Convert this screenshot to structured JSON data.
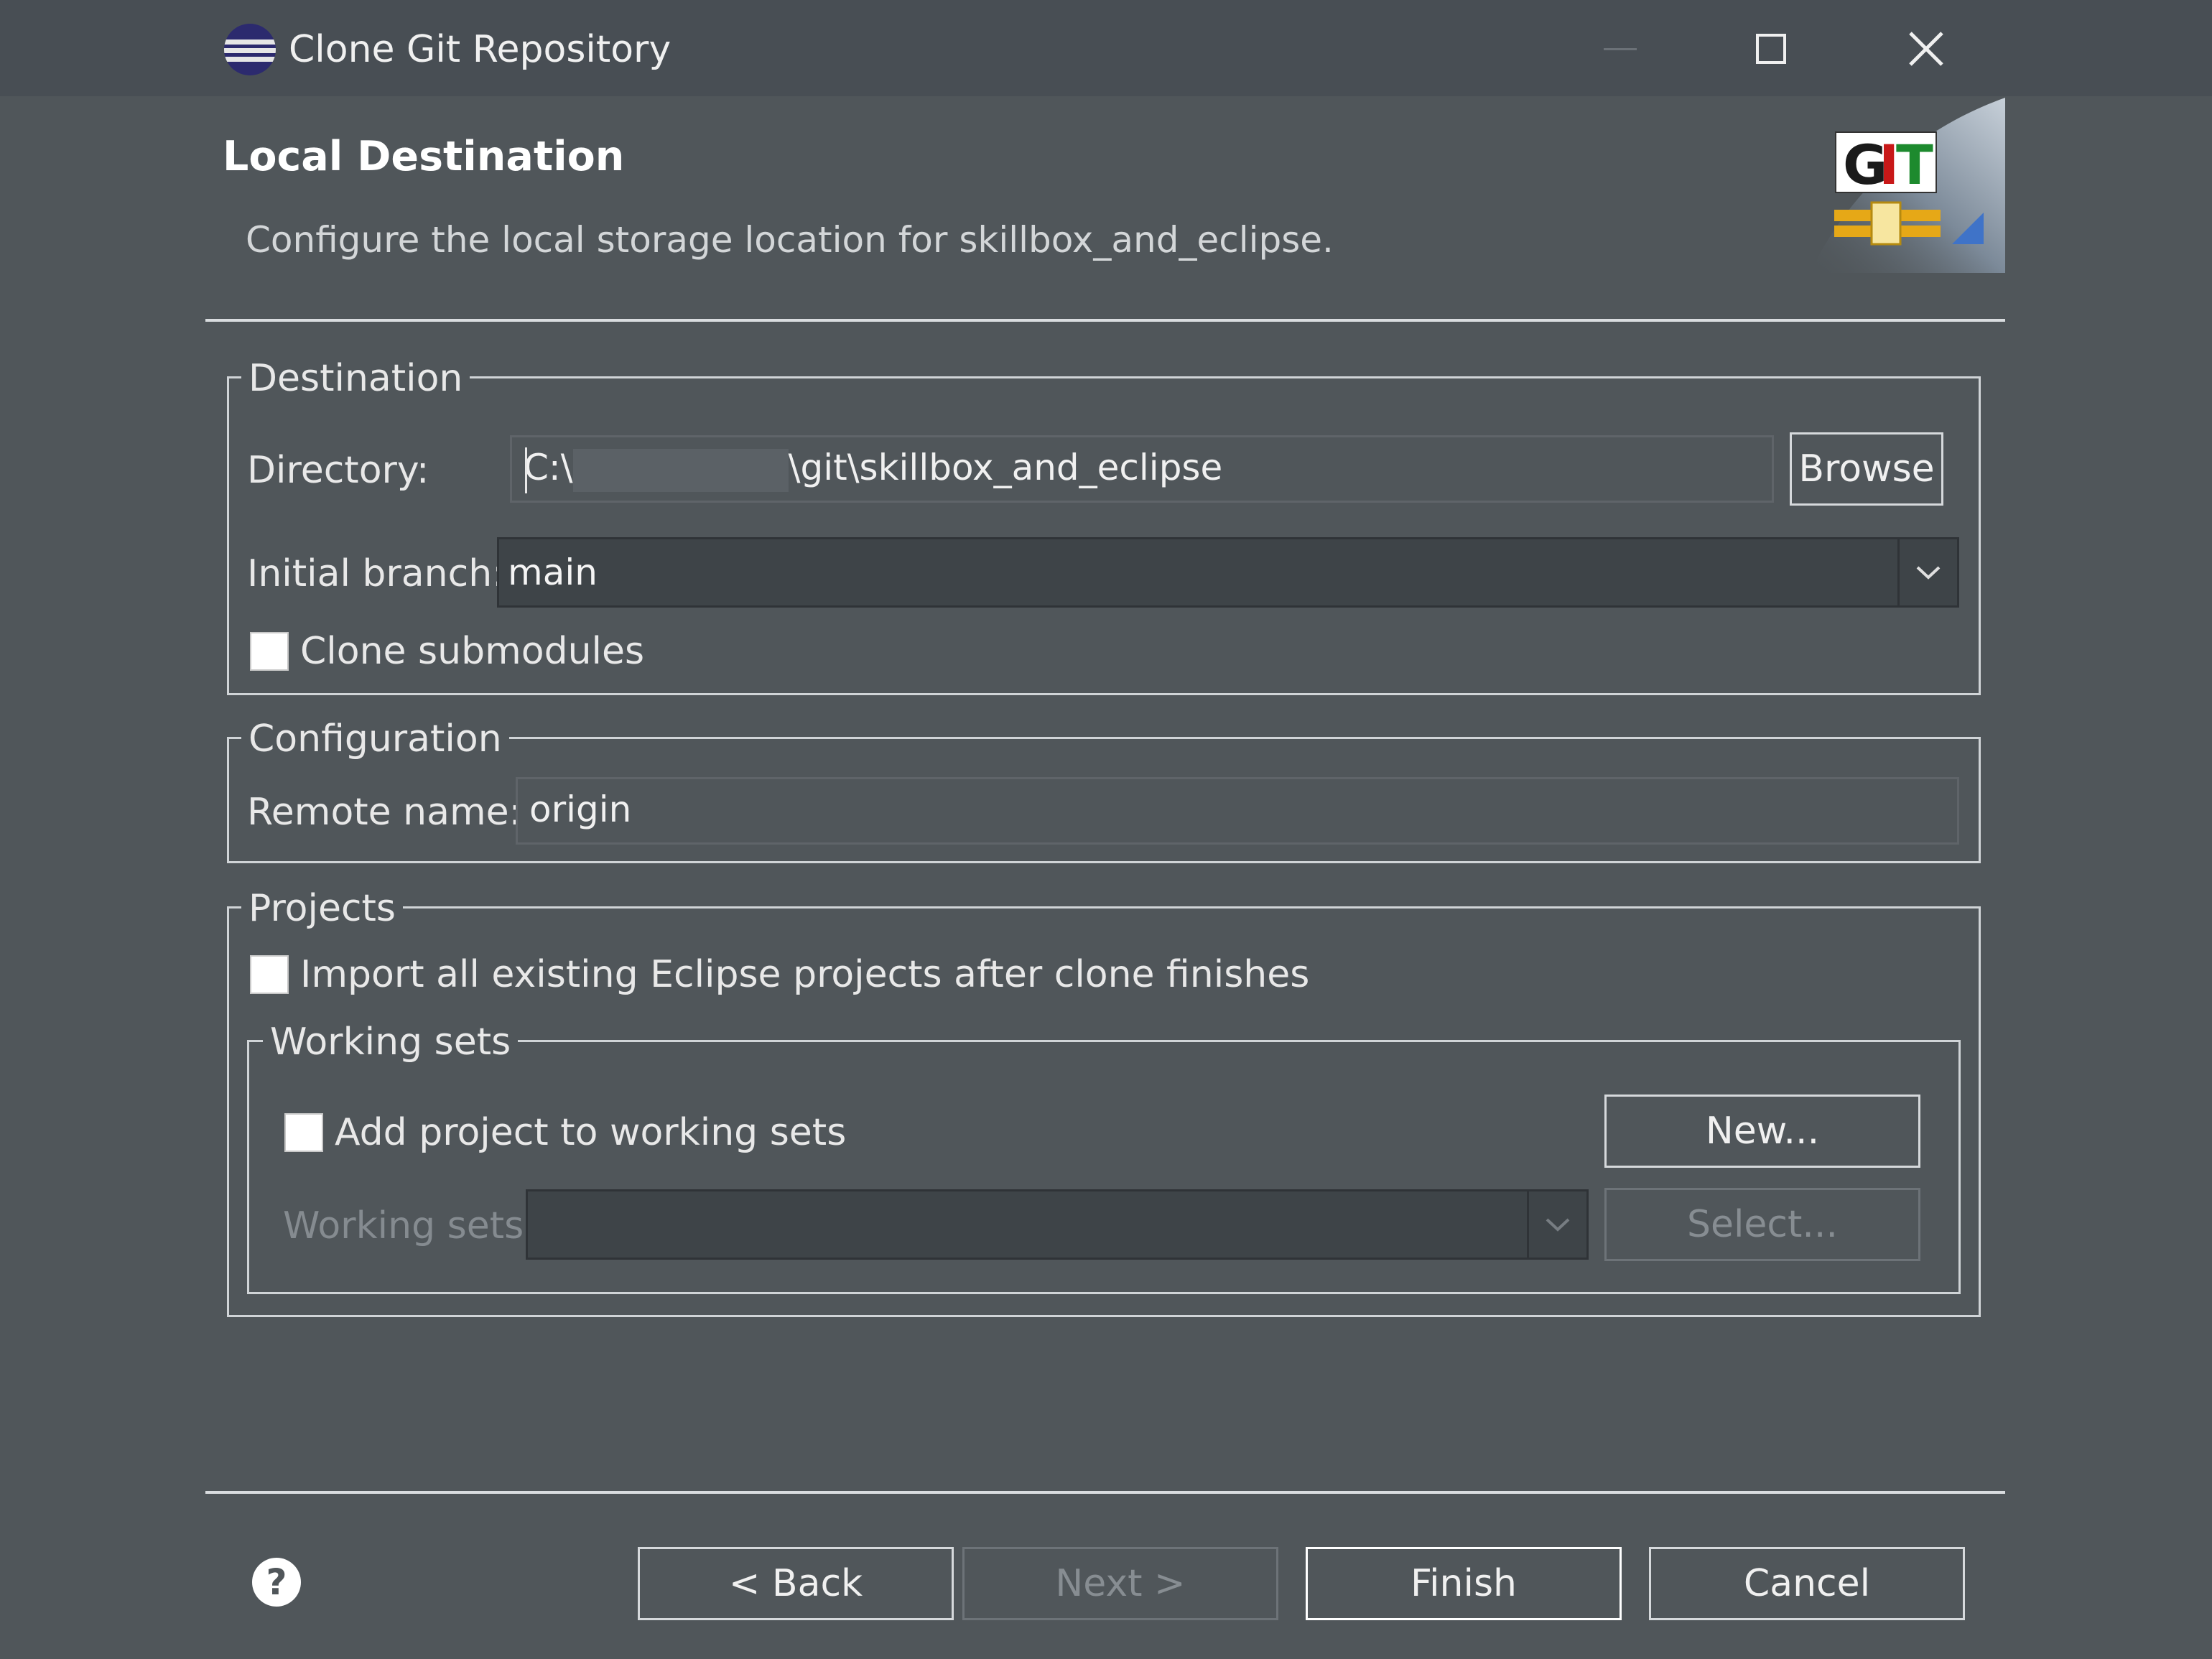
{
  "window": {
    "title": "Clone Git Repository",
    "app_icon": "eclipse-icon",
    "controls": {
      "minimize": "minimize-icon",
      "maximize": "maximize-icon",
      "close": "close-icon"
    }
  },
  "header": {
    "title": "Local Destination",
    "description": "Configure the local storage location for skillbox_and_eclipse.",
    "logo_icon": "git-logo-icon",
    "logo_text": {
      "g": "G",
      "i": "I",
      "t": "T"
    }
  },
  "destination": {
    "legend": "Destination",
    "directory_label": "Directory:",
    "directory_prefix": "C:\\",
    "directory_suffix": "\\git\\skillbox_and_eclipse",
    "browse_label": "Browse",
    "initial_branch_label": "Initial branch:",
    "initial_branch_value": "main",
    "clone_submodules_label": "Clone submodules",
    "clone_submodules_checked": false
  },
  "configuration": {
    "legend": "Configuration",
    "remote_name_label": "Remote name:",
    "remote_name_value": "origin"
  },
  "projects": {
    "legend": "Projects",
    "import_label": "Import all existing Eclipse projects after clone finishes",
    "import_checked": false,
    "working_sets": {
      "legend": "Working sets",
      "add_label": "Add project to working sets",
      "add_checked": false,
      "new_label": "New...",
      "working_sets_label": "Working sets:",
      "working_sets_value": "",
      "select_label": "Select..."
    }
  },
  "footer": {
    "help_icon": "help-icon",
    "back_label": "< Back",
    "next_label": "Next >",
    "finish_label": "Finish",
    "cancel_label": "Cancel"
  },
  "colors": {
    "background": "#50565a",
    "titlebar": "#484e54",
    "field_dark": "#3e4448",
    "border_light": "#d0d4d7"
  }
}
